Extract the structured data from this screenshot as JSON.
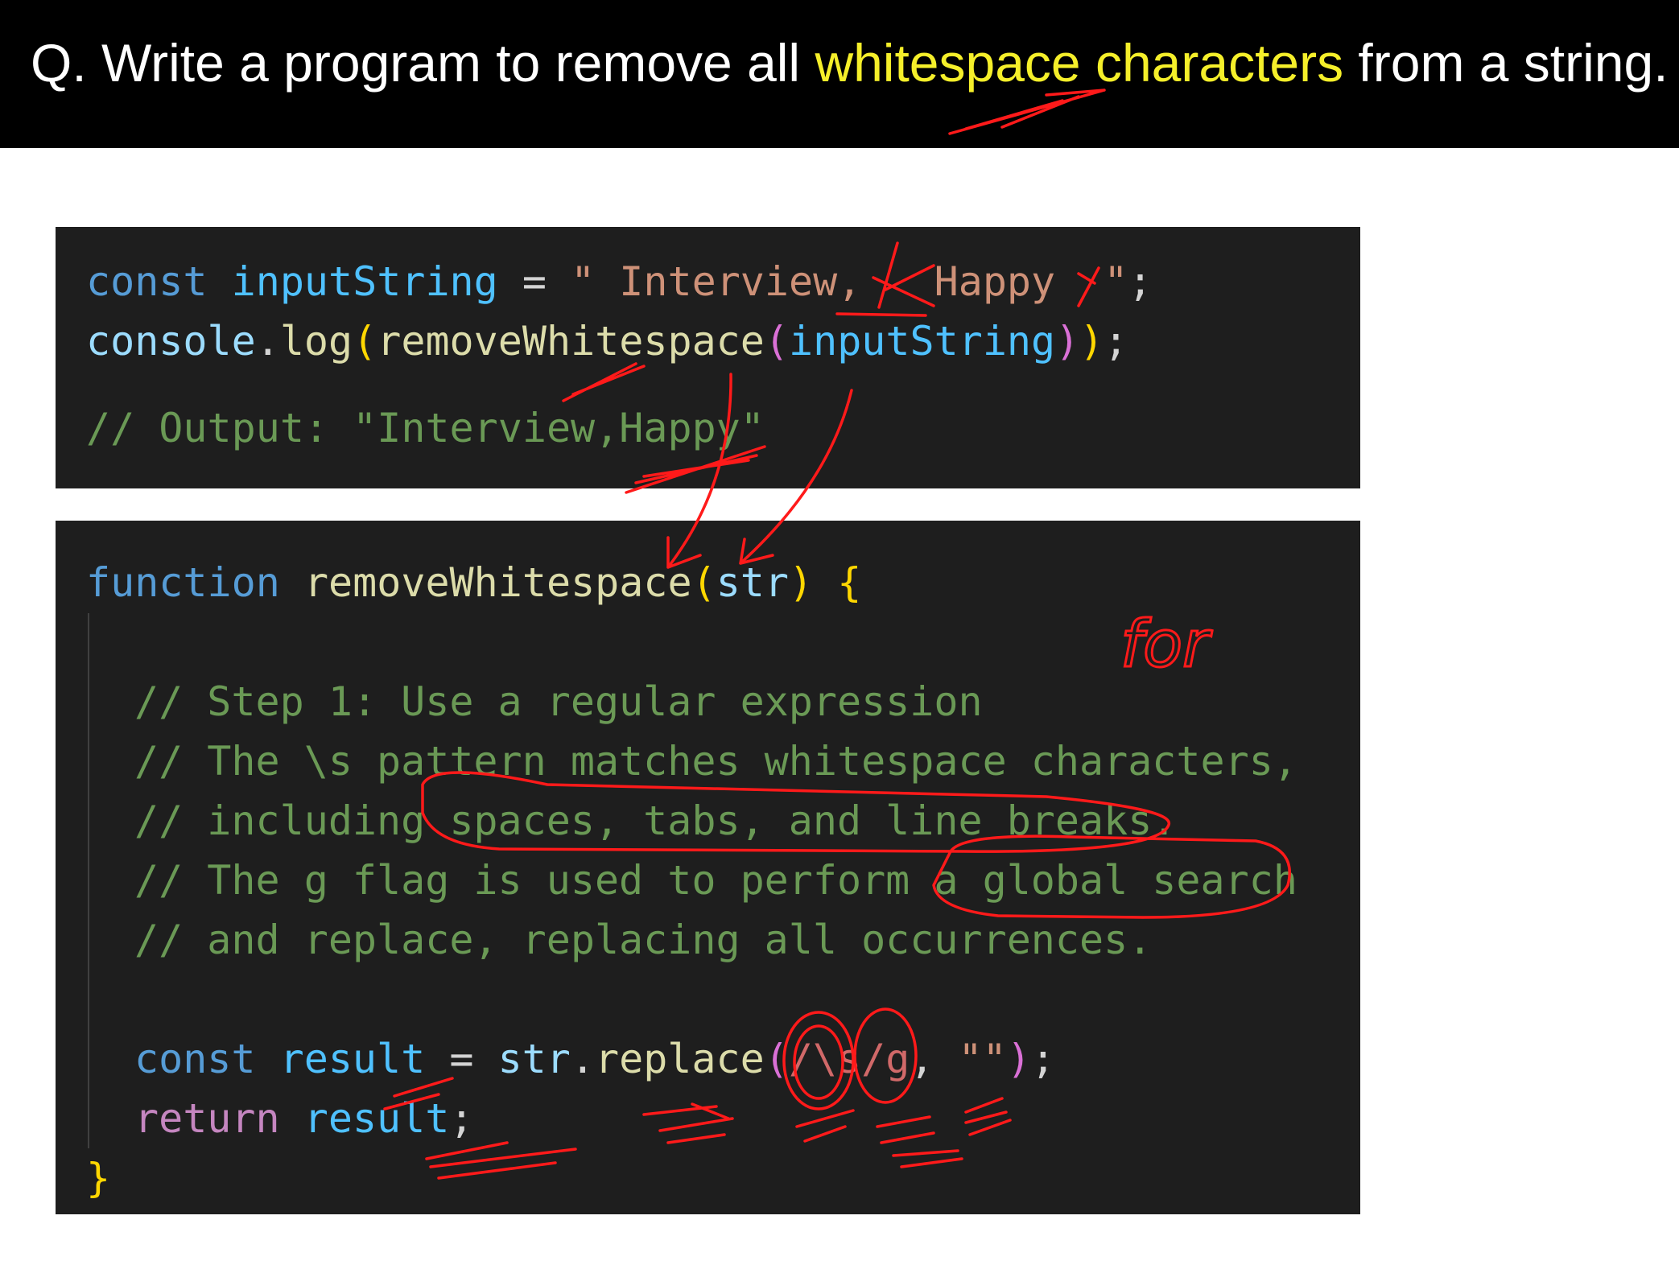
{
  "question": {
    "prefix": "Q. Write a program to remove all ",
    "highlight": "whitespace characters",
    "suffix": " from a string."
  },
  "code_block_1": {
    "line1": {
      "kw": "const",
      "name": "inputString",
      "op": " = ",
      "string": "\" Interview,   Happy  \"",
      "end": ";"
    },
    "line2": {
      "obj": "console",
      "dot": ".",
      "method": "log",
      "open1": "(",
      "call": "removeWhitespace",
      "open2": "(",
      "arg": "inputString",
      "close2": ")",
      "close1": ")",
      "end": ";"
    },
    "line3": "// Output: \"Interview,Happy\""
  },
  "code_block_2": {
    "signature": {
      "kw": "function",
      "name": "removeWhitespace",
      "open": "(",
      "param": "str",
      "close": ")",
      "brace": "{"
    },
    "comments": [
      "// Step 1: Use a regular expression",
      "// The \\s pattern matches whitespace characters,",
      "// including spaces, tabs, and line breaks.",
      "// The g flag is used to perform a global search",
      "// and replace, replacing all occurrences."
    ],
    "result_line": {
      "kw": "const",
      "name": "result",
      "op": " = ",
      "obj": "str",
      "dot": ".",
      "method": "replace",
      "open": "(",
      "regex": "/\\s/g",
      "comma": ", ",
      "empty": "\"\"",
      "close": ")",
      "end": ";"
    },
    "return_line": {
      "kw": "return",
      "name": "result",
      "end": ";"
    },
    "closing_brace": "}"
  },
  "annotation_text": "for",
  "colors": {
    "header_bg": "#000000",
    "highlight": "#f5ef2a",
    "code_bg": "#1e1e1e",
    "ink": "#ff1a1a"
  }
}
